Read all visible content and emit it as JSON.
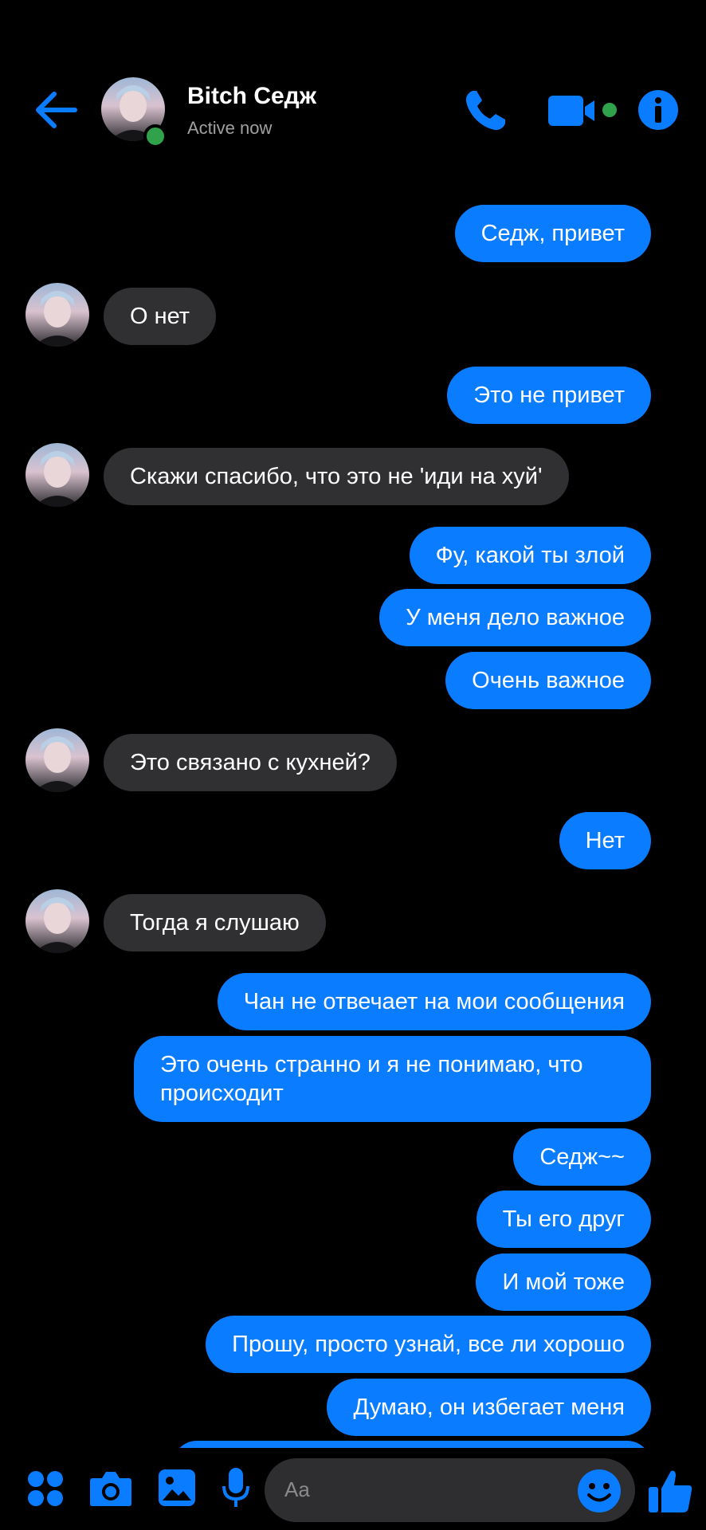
{
  "colors": {
    "accent": "#0a7cff",
    "incoming_bubble": "#303033",
    "online": "#31a24c",
    "background": "#000000"
  },
  "header": {
    "contact_name": "Bitch Седж",
    "status": "Active now",
    "icons": [
      "back-arrow-icon",
      "avatar",
      "phone-icon",
      "video-camera-icon",
      "info-icon"
    ]
  },
  "messages": [
    {
      "from": "me",
      "text": "Седж, привет"
    },
    {
      "from": "them",
      "text": "О нет"
    },
    {
      "from": "me",
      "text": "Это не привет"
    },
    {
      "from": "them",
      "text": "Скажи спасибо, что это не 'иди на хуй'"
    },
    {
      "from": "me",
      "text": "Фу, какой ты злой"
    },
    {
      "from": "me",
      "text": "У меня дело важное"
    },
    {
      "from": "me",
      "text": "Очень важное"
    },
    {
      "from": "them",
      "text": "Это связано с кухней?"
    },
    {
      "from": "me",
      "text": "Нет"
    },
    {
      "from": "them",
      "text": "Тогда я слушаю"
    },
    {
      "from": "me",
      "text": "Чан не отвечает на мои сообщения"
    },
    {
      "from": "me",
      "text": "Это очень странно и я не понимаю, что происходит"
    },
    {
      "from": "me",
      "text": "Седж~~"
    },
    {
      "from": "me",
      "text": "Ты его друг"
    },
    {
      "from": "me",
      "text": "И мой тоже"
    },
    {
      "from": "me",
      "text": "Прошу, просто узнай, все ли хорошо"
    },
    {
      "from": "me",
      "text": "Думаю, он избегает меня"
    }
  ],
  "composer": {
    "placeholder": "Aa",
    "icons": [
      "apps-icon",
      "camera-icon",
      "gallery-icon",
      "microphone-icon",
      "emoji-icon",
      "thumbs-up-icon"
    ]
  }
}
